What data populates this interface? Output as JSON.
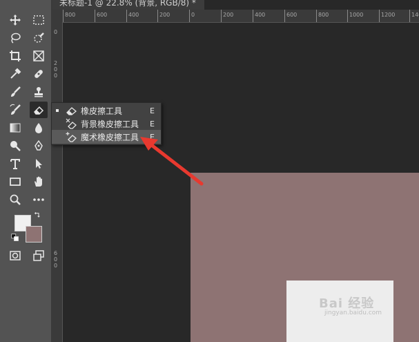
{
  "document": {
    "tab_title": "未标题-1 @ 22.8% (背景, RGB/8) *"
  },
  "rulers": {
    "horizontal_labels": [
      "800",
      "600",
      "400",
      "200",
      "0",
      "200",
      "400",
      "600",
      "800",
      "1000",
      "1200",
      "1400"
    ],
    "vertical_labels": [
      "0",
      "2",
      "0",
      "0",
      "4",
      "0",
      "0",
      "6",
      "0",
      "0"
    ]
  },
  "eraser_flyout": {
    "items": [
      {
        "label": "橡皮擦工具",
        "shortcut": "E",
        "icon": "eraser-icon",
        "selected": true
      },
      {
        "label": "背景橡皮擦工具",
        "shortcut": "E",
        "icon": "background-eraser-icon",
        "selected": false
      },
      {
        "label": "魔术橡皮擦工具",
        "shortcut": "E",
        "icon": "magic-eraser-icon",
        "selected": false,
        "hovered": true
      }
    ]
  },
  "colors": {
    "foreground": "#f0f0f0",
    "background": "#8e7373",
    "annotation_arrow": "#e8392f"
  },
  "watermark": {
    "brand": "Bai 经验",
    "sub": "jingyan.baidu.com"
  }
}
